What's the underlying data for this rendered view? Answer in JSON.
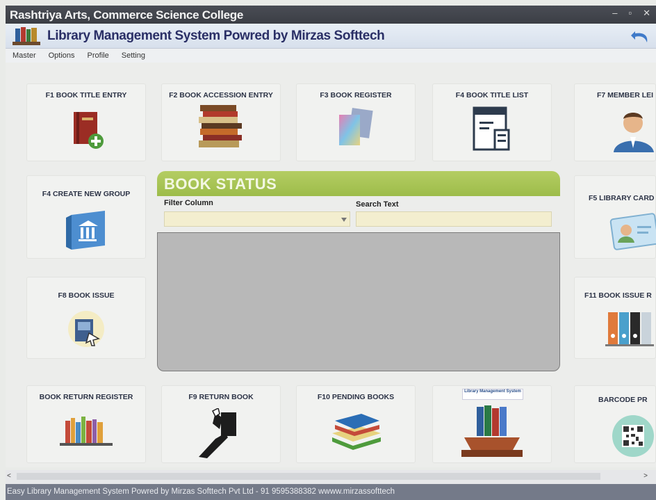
{
  "window": {
    "title": "Rashtriya Arts, Commerce Science College",
    "controls": [
      "–",
      "▫",
      "✕"
    ]
  },
  "header": {
    "app_title": "Library Management System Powred by Mirzas Softtech"
  },
  "menu": [
    "Master",
    "Options",
    "Profile",
    "Setting"
  ],
  "tiles": {
    "book_title_entry": "F1 BOOK TITLE ENTRY",
    "book_accession_entry": "F2 BOOK ACCESSION ENTRY",
    "book_register": "F3 BOOK REGISTER",
    "book_title_list": "F4 BOOK TITLE LIST",
    "member_ledger": "F7 MEMBER LEI",
    "create_new_group": "F4 CREATE NEW GROUP",
    "library_card": "F5 LIBRARY CARD",
    "book_issue": "F8 BOOK ISSUE",
    "book_issue_register": "F11 BOOK ISSUE R",
    "book_return_register": "BOOK RETURN REGISTER",
    "return_book": "F9 RETURN BOOK",
    "pending_books": "F10 PENDING BOOKS",
    "library_logo_caption": "Library Management System",
    "barcode_print": "BARCODE PR"
  },
  "book_status": {
    "title": "BOOK STATUS",
    "filter_column_label": "Filter Column",
    "filter_column_value": "",
    "search_text_label": "Search Text",
    "search_text_value": ""
  },
  "scroll": {
    "left": "<",
    "right": ">"
  },
  "statusbar": "Easy Library Management System Powred by Mirzas Softtech Pvt Ltd - 91 9595388382 wwww.mirzassofttech",
  "colors": {
    "titlebar": "#3b3e45",
    "app_title": "#2a2f66",
    "status_header": "#a7c354",
    "grid": "#b8b8b8",
    "field": "#f3eecf",
    "statusbar": "#747a89"
  }
}
